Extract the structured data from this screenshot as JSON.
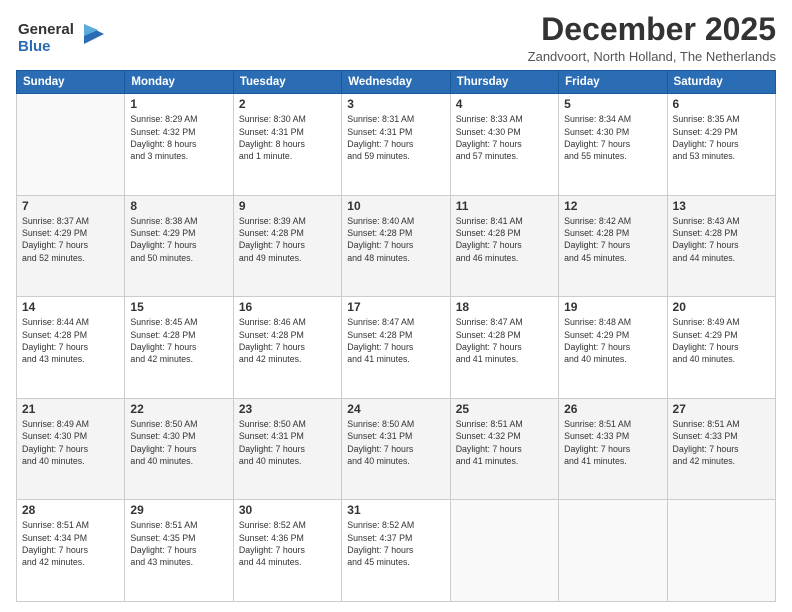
{
  "logo": {
    "line1": "General",
    "line2": "Blue"
  },
  "title": "December 2025",
  "subtitle": "Zandvoort, North Holland, The Netherlands",
  "weekdays": [
    "Sunday",
    "Monday",
    "Tuesday",
    "Wednesday",
    "Thursday",
    "Friday",
    "Saturday"
  ],
  "weeks": [
    [
      {
        "day": "",
        "info": ""
      },
      {
        "day": "1",
        "info": "Sunrise: 8:29 AM\nSunset: 4:32 PM\nDaylight: 8 hours\nand 3 minutes."
      },
      {
        "day": "2",
        "info": "Sunrise: 8:30 AM\nSunset: 4:31 PM\nDaylight: 8 hours\nand 1 minute."
      },
      {
        "day": "3",
        "info": "Sunrise: 8:31 AM\nSunset: 4:31 PM\nDaylight: 7 hours\nand 59 minutes."
      },
      {
        "day": "4",
        "info": "Sunrise: 8:33 AM\nSunset: 4:30 PM\nDaylight: 7 hours\nand 57 minutes."
      },
      {
        "day": "5",
        "info": "Sunrise: 8:34 AM\nSunset: 4:30 PM\nDaylight: 7 hours\nand 55 minutes."
      },
      {
        "day": "6",
        "info": "Sunrise: 8:35 AM\nSunset: 4:29 PM\nDaylight: 7 hours\nand 53 minutes."
      }
    ],
    [
      {
        "day": "7",
        "info": "Sunrise: 8:37 AM\nSunset: 4:29 PM\nDaylight: 7 hours\nand 52 minutes."
      },
      {
        "day": "8",
        "info": "Sunrise: 8:38 AM\nSunset: 4:29 PM\nDaylight: 7 hours\nand 50 minutes."
      },
      {
        "day": "9",
        "info": "Sunrise: 8:39 AM\nSunset: 4:28 PM\nDaylight: 7 hours\nand 49 minutes."
      },
      {
        "day": "10",
        "info": "Sunrise: 8:40 AM\nSunset: 4:28 PM\nDaylight: 7 hours\nand 48 minutes."
      },
      {
        "day": "11",
        "info": "Sunrise: 8:41 AM\nSunset: 4:28 PM\nDaylight: 7 hours\nand 46 minutes."
      },
      {
        "day": "12",
        "info": "Sunrise: 8:42 AM\nSunset: 4:28 PM\nDaylight: 7 hours\nand 45 minutes."
      },
      {
        "day": "13",
        "info": "Sunrise: 8:43 AM\nSunset: 4:28 PM\nDaylight: 7 hours\nand 44 minutes."
      }
    ],
    [
      {
        "day": "14",
        "info": "Sunrise: 8:44 AM\nSunset: 4:28 PM\nDaylight: 7 hours\nand 43 minutes."
      },
      {
        "day": "15",
        "info": "Sunrise: 8:45 AM\nSunset: 4:28 PM\nDaylight: 7 hours\nand 42 minutes."
      },
      {
        "day": "16",
        "info": "Sunrise: 8:46 AM\nSunset: 4:28 PM\nDaylight: 7 hours\nand 42 minutes."
      },
      {
        "day": "17",
        "info": "Sunrise: 8:47 AM\nSunset: 4:28 PM\nDaylight: 7 hours\nand 41 minutes."
      },
      {
        "day": "18",
        "info": "Sunrise: 8:47 AM\nSunset: 4:28 PM\nDaylight: 7 hours\nand 41 minutes."
      },
      {
        "day": "19",
        "info": "Sunrise: 8:48 AM\nSunset: 4:29 PM\nDaylight: 7 hours\nand 40 minutes."
      },
      {
        "day": "20",
        "info": "Sunrise: 8:49 AM\nSunset: 4:29 PM\nDaylight: 7 hours\nand 40 minutes."
      }
    ],
    [
      {
        "day": "21",
        "info": "Sunrise: 8:49 AM\nSunset: 4:30 PM\nDaylight: 7 hours\nand 40 minutes."
      },
      {
        "day": "22",
        "info": "Sunrise: 8:50 AM\nSunset: 4:30 PM\nDaylight: 7 hours\nand 40 minutes."
      },
      {
        "day": "23",
        "info": "Sunrise: 8:50 AM\nSunset: 4:31 PM\nDaylight: 7 hours\nand 40 minutes."
      },
      {
        "day": "24",
        "info": "Sunrise: 8:50 AM\nSunset: 4:31 PM\nDaylight: 7 hours\nand 40 minutes."
      },
      {
        "day": "25",
        "info": "Sunrise: 8:51 AM\nSunset: 4:32 PM\nDaylight: 7 hours\nand 41 minutes."
      },
      {
        "day": "26",
        "info": "Sunrise: 8:51 AM\nSunset: 4:33 PM\nDaylight: 7 hours\nand 41 minutes."
      },
      {
        "day": "27",
        "info": "Sunrise: 8:51 AM\nSunset: 4:33 PM\nDaylight: 7 hours\nand 42 minutes."
      }
    ],
    [
      {
        "day": "28",
        "info": "Sunrise: 8:51 AM\nSunset: 4:34 PM\nDaylight: 7 hours\nand 42 minutes."
      },
      {
        "day": "29",
        "info": "Sunrise: 8:51 AM\nSunset: 4:35 PM\nDaylight: 7 hours\nand 43 minutes."
      },
      {
        "day": "30",
        "info": "Sunrise: 8:52 AM\nSunset: 4:36 PM\nDaylight: 7 hours\nand 44 minutes."
      },
      {
        "day": "31",
        "info": "Sunrise: 8:52 AM\nSunset: 4:37 PM\nDaylight: 7 hours\nand 45 minutes."
      },
      {
        "day": "",
        "info": ""
      },
      {
        "day": "",
        "info": ""
      },
      {
        "day": "",
        "info": ""
      }
    ]
  ]
}
